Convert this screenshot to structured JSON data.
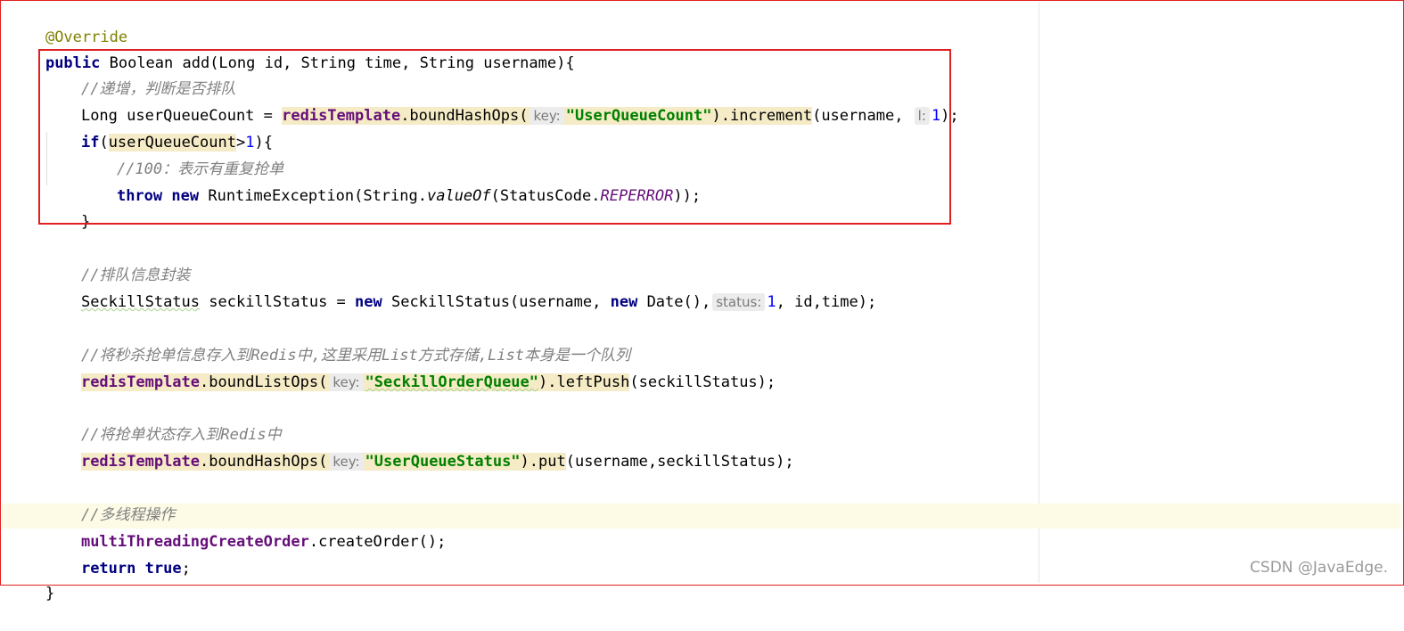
{
  "code": {
    "annotation": "@Override",
    "signature": {
      "kw_public": "public",
      "rest": " Boolean add(Long id, String time, String username){"
    },
    "comment_increment": "//递增，判断是否排队",
    "line_increment": {
      "pre": "Long userQueueCount = ",
      "field": "redisTemplate",
      "method": ".boundHashOps(",
      "hint_key": "key:",
      "str": "\"UserQueueCount\"",
      "method2": ").increment",
      "args": "(username, ",
      "hint_l": "l:",
      "num": "1",
      "end": ");"
    },
    "line_if": {
      "kw": "if",
      "open": "(",
      "var": "userQueueCount",
      "op": ">",
      "num": "1",
      "end": "){"
    },
    "comment_100": "//100：表示有重复抢单",
    "line_throw": {
      "kw_throw": "throw",
      "kw_new": "new",
      "pre": " RuntimeException(String.",
      "static": "valueOf",
      "mid": "(StatusCode.",
      "const": "REPERROR",
      "end": "));"
    },
    "close_brace": "}",
    "comment_status": "//排队信息封装",
    "line_status": {
      "type": "SeckillStatus",
      "pre": " seckillStatus = ",
      "kw_new": "new",
      "mid": " SeckillStatus(username, ",
      "kw_new2": "new",
      "mid2": " Date(),",
      "hint_status": "status:",
      "num": "1",
      "end": ", id,time);"
    },
    "comment_list": "//将秒杀抢单信息存入到Redis中,这里采用List方式存储,List本身是一个队列",
    "line_list": {
      "field": "redisTemplate",
      "method": ".boundListOps(",
      "hint_key": "key:",
      "str": "\"SeckillOrderQueue\"",
      "method2": ").leftPush",
      "end": "(seckillStatus);"
    },
    "comment_state": "//将抢单状态存入到Redis中",
    "line_state": {
      "field": "redisTemplate",
      "method": ".boundHashOps(",
      "hint_key": "key:",
      "str": "\"UserQueueStatus\"",
      "method2": ").put",
      "end": "(username,seckillStatus);"
    },
    "comment_thread": "//多线程操作",
    "line_thread": {
      "field": "multiThreadingCreateOrder",
      "end": ".createOrder();"
    },
    "line_return": {
      "kw": "return",
      "kw2": "true",
      "end": ";"
    },
    "final_brace": "}"
  },
  "watermark": "CSDN @JavaEdge.",
  "colors": {
    "keyword": "#000080",
    "annotation": "#808000",
    "comment": "#808080",
    "string": "#008000",
    "field": "#660e7a",
    "number": "#0000ff",
    "usage_highlight": "#f5ebc6",
    "frame_red": "#e02020"
  }
}
